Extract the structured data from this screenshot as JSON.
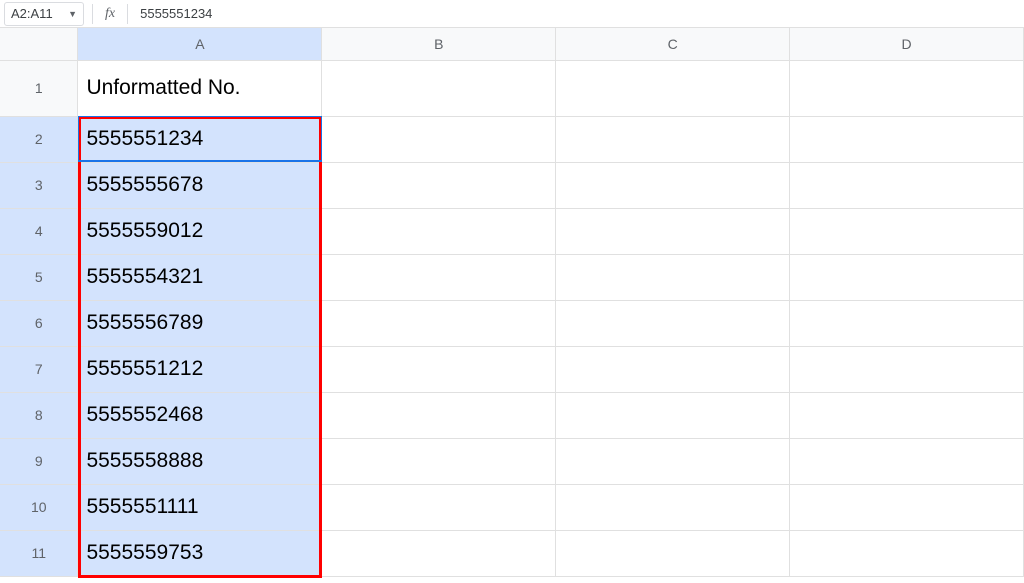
{
  "formula_bar": {
    "name_box": "A2:A11",
    "fx": "fx",
    "value": "5555551234"
  },
  "columns": [
    "A",
    "B",
    "C",
    "D"
  ],
  "rows": [
    "1",
    "2",
    "3",
    "4",
    "5",
    "6",
    "7",
    "8",
    "9",
    "10",
    "11"
  ],
  "cells": {
    "A1": "Unformatted No.",
    "A2": "5555551234",
    "A3": "5555555678",
    "A4": "5555559012",
    "A5": "5555554321",
    "A6": "5555556789",
    "A7": "5555551212",
    "A8": "5555552468",
    "A9": "5555558888",
    "A10": "5555551111",
    "A11": "5555559753"
  },
  "selection": {
    "range": "A2:A11",
    "active": "A2"
  }
}
